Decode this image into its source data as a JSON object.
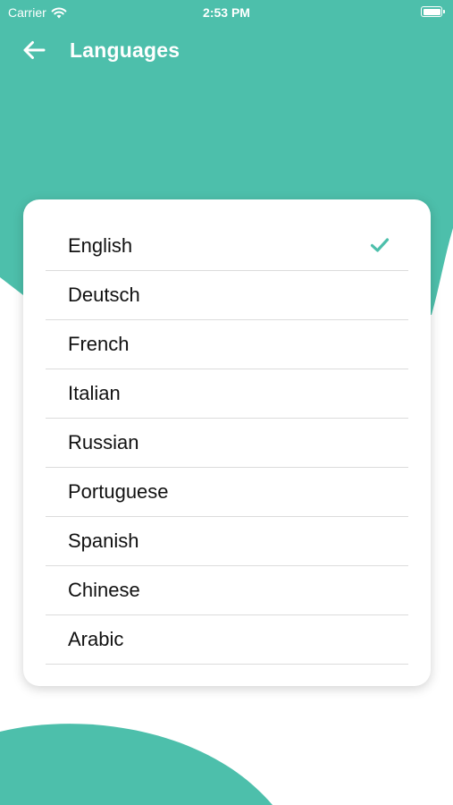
{
  "status_bar": {
    "carrier": "Carrier",
    "time": "2:53 PM",
    "wifi_icon": "wifi-icon",
    "battery_icon": "battery-icon"
  },
  "header": {
    "back_icon": "arrow-left-icon",
    "title": "Languages"
  },
  "languages": {
    "selected": "English",
    "items": [
      {
        "label": "English",
        "selected": true
      },
      {
        "label": "Deutsch",
        "selected": false
      },
      {
        "label": "French",
        "selected": false
      },
      {
        "label": "Italian",
        "selected": false
      },
      {
        "label": "Russian",
        "selected": false
      },
      {
        "label": "Portuguese",
        "selected": false
      },
      {
        "label": "Spanish",
        "selected": false
      },
      {
        "label": "Chinese",
        "selected": false
      },
      {
        "label": "Arabic",
        "selected": false
      }
    ],
    "check_icon": "checkmark-icon"
  },
  "colors": {
    "accent": "#4dbfab",
    "background": "#ffffff",
    "text": "#111111",
    "divider": "#dcdcdc"
  }
}
